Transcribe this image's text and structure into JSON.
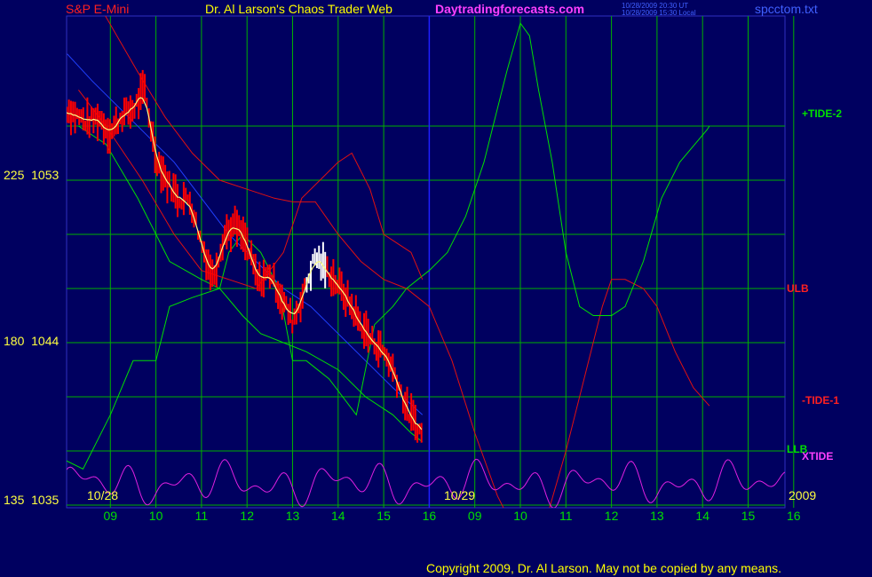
{
  "header": {
    "instrument": "S&P E-Mini",
    "title": "Dr. Al Larson's Chaos Trader Web",
    "site": "Daytradingforecasts.com",
    "ut_stamp": "10/28/2009 20:30 UT",
    "local_stamp": "10/28/2009 15:30 Local",
    "file": "spcctom.txt"
  },
  "footer": {
    "copyright": "Copyright 2009, Dr. Al Larson. May not be copied by any means."
  },
  "colors": {
    "background": "#000060",
    "grid": "#00b000",
    "divider": "#2020ff",
    "price": "#ff0000",
    "price_up": "#ffffff",
    "moving_avg": "#ffff80",
    "tide1": "#e01010",
    "tide2": "#00e000",
    "xtide": "#e020e0",
    "channel": "#e01010",
    "blue_line": "#2040ff"
  },
  "chart_data": {
    "type": "line",
    "title": "S&P E-Mini",
    "y_axis": {
      "ticks": [
        {
          "left": "225",
          "right": "1053",
          "value": 1053
        },
        {
          "left": "180",
          "right": "1044",
          "value": 1044
        },
        {
          "left": "135",
          "right": "1035",
          "value": 1035
        }
      ],
      "ylim": [
        1035,
        1053
      ]
    },
    "x_axis": {
      "date_labels": [
        "10/28",
        "10/29",
        "2009"
      ],
      "hour_labels": [
        "09",
        "10",
        "11",
        "12",
        "13",
        "14",
        "15",
        "16",
        "09",
        "10",
        "11",
        "12",
        "13",
        "14",
        "15",
        "16"
      ],
      "sessions": [
        "10/28",
        "10/29"
      ]
    },
    "series": [
      {
        "name": "+TIDE-2",
        "color": "#00e000"
      },
      {
        "name": "ULB",
        "color": "#e01010"
      },
      {
        "name": "-TIDE-1",
        "color": "#e01010"
      },
      {
        "name": "LLB",
        "color": "#00e000"
      },
      {
        "name": "XTIDE",
        "color": "#e020e0"
      }
    ],
    "right_labels": [
      {
        "text": "+TIDE-2",
        "color": "#00e000"
      },
      {
        "text": "ULB",
        "color": "#ff2020"
      },
      {
        "text": "-TIDE-1",
        "color": "#ff2020"
      },
      {
        "text": "LLB",
        "color": "#00e000"
      },
      {
        "text": "XTIDE",
        "color": "#ff40ff"
      }
    ],
    "price_path": [
      [
        0,
        1057.0
      ],
      [
        0.25,
        1056.6
      ],
      [
        0.5,
        1056.2
      ],
      [
        0.75,
        1056.5
      ],
      [
        1.0,
        1055.6
      ],
      [
        1.25,
        1056.6
      ],
      [
        1.5,
        1056.9
      ],
      [
        1.75,
        1058.0
      ],
      [
        2.0,
        1054.3
      ],
      [
        2.25,
        1052.9
      ],
      [
        2.5,
        1052.0
      ],
      [
        2.75,
        1051.9
      ],
      [
        3.0,
        1049.5
      ],
      [
        3.25,
        1047.6
      ],
      [
        3.5,
        1050.0
      ],
      [
        3.75,
        1050.5
      ],
      [
        4.0,
        1049.4
      ],
      [
        4.25,
        1047.3
      ],
      [
        4.5,
        1047.9
      ],
      [
        4.75,
        1046.5
      ],
      [
        5.0,
        1045.2
      ],
      [
        5.25,
        1046.8
      ],
      [
        5.5,
        1048.8
      ],
      [
        5.75,
        1048.0
      ],
      [
        6.0,
        1047.2
      ],
      [
        6.25,
        1046.2
      ],
      [
        6.5,
        1045.0
      ],
      [
        6.75,
        1044.1
      ],
      [
        7.0,
        1043.5
      ],
      [
        7.25,
        1042.3
      ],
      [
        7.5,
        1040.3
      ],
      [
        7.75,
        1039.3
      ],
      [
        7.85,
        1038.8
      ]
    ],
    "white_bars_hour": [
      5.3,
      5.75
    ],
    "tide2_path": [
      [
        0.0,
        1037.5
      ],
      [
        0.4,
        1037.0
      ],
      [
        1.0,
        1040.0
      ],
      [
        1.5,
        1043.0
      ],
      [
        2.0,
        1043.0
      ],
      [
        2.3,
        1046.0
      ],
      [
        2.8,
        1046.5
      ],
      [
        3.4,
        1047.0
      ],
      [
        3.6,
        1049.0
      ],
      [
        3.9,
        1050.0
      ],
      [
        4.3,
        1049.0
      ],
      [
        4.7,
        1047.0
      ],
      [
        5.0,
        1043.0
      ],
      [
        5.3,
        1043.0
      ],
      [
        5.8,
        1042.0
      ],
      [
        6.4,
        1040.0
      ],
      [
        6.8,
        1045.0
      ],
      [
        7.2,
        1046.0
      ],
      [
        7.5,
        1047.0
      ],
      [
        8.0,
        1048.0
      ],
      [
        8.4,
        1049.0
      ],
      [
        8.8,
        1051.0
      ],
      [
        9.2,
        1054.0
      ],
      [
        9.7,
        1059.0
      ],
      [
        10.0,
        1061.7
      ],
      [
        10.2,
        1061.0
      ],
      [
        10.4,
        1058.0
      ],
      [
        10.7,
        1054.0
      ],
      [
        11.0,
        1049.0
      ],
      [
        11.3,
        1046.0
      ],
      [
        11.6,
        1045.5
      ],
      [
        12.0,
        1045.5
      ],
      [
        12.3,
        1046.0
      ],
      [
        12.7,
        1048.5
      ],
      [
        13.1,
        1052.0
      ],
      [
        13.5,
        1054.0
      ],
      [
        14.0,
        1055.5
      ],
      [
        14.1,
        1055.8
      ],
      [
        14.15,
        1056.0
      ]
    ],
    "tide1_path": [
      [
        0.0,
        1065.0
      ],
      [
        0.8,
        1062.5
      ],
      [
        1.6,
        1059.0
      ],
      [
        2.2,
        1056.5
      ],
      [
        2.8,
        1054.5
      ],
      [
        3.4,
        1053.0
      ],
      [
        4.0,
        1052.5
      ],
      [
        4.6,
        1052.0
      ],
      [
        5.0,
        1051.8
      ],
      [
        5.5,
        1051.8
      ],
      [
        6.0,
        1050.0
      ],
      [
        6.5,
        1048.5
      ],
      [
        7.0,
        1047.5
      ],
      [
        7.5,
        1047.0
      ],
      [
        8.0,
        1046.0
      ],
      [
        8.5,
        1043.0
      ],
      [
        9.0,
        1039.0
      ],
      [
        9.5,
        1035.5
      ],
      [
        9.9,
        1033.5
      ],
      [
        10.2,
        1033.0
      ],
      [
        10.6,
        1034.5
      ],
      [
        11.0,
        1038.0
      ],
      [
        11.4,
        1042.0
      ],
      [
        11.8,
        1046.0
      ],
      [
        12.0,
        1047.5
      ],
      [
        12.3,
        1047.5
      ],
      [
        12.7,
        1047.0
      ],
      [
        13.0,
        1046.0
      ],
      [
        13.4,
        1043.5
      ],
      [
        13.8,
        1041.5
      ],
      [
        14.15,
        1040.5
      ]
    ],
    "ulb_path": [
      [
        0.3,
        1058.0
      ],
      [
        0.9,
        1056.0
      ],
      [
        1.7,
        1053.0
      ],
      [
        2.4,
        1050.0
      ],
      [
        3.0,
        1048.0
      ],
      [
        3.6,
        1047.5
      ],
      [
        4.2,
        1047.0
      ],
      [
        4.8,
        1049.0
      ],
      [
        5.2,
        1052.0
      ],
      [
        5.6,
        1053.0
      ],
      [
        6.0,
        1054.0
      ],
      [
        6.3,
        1054.5
      ],
      [
        6.7,
        1052.5
      ],
      [
        7.0,
        1050.0
      ],
      [
        7.3,
        1049.5
      ],
      [
        7.6,
        1049.0
      ],
      [
        7.85,
        1047.5
      ]
    ],
    "llb_path": [
      [
        0.3,
        1056.0
      ],
      [
        0.9,
        1055.0
      ],
      [
        1.6,
        1052.0
      ],
      [
        2.3,
        1048.5
      ],
      [
        3.0,
        1047.5
      ],
      [
        3.4,
        1047.0
      ],
      [
        3.9,
        1045.5
      ],
      [
        4.3,
        1044.5
      ],
      [
        4.8,
        1044.0
      ],
      [
        5.3,
        1043.5
      ],
      [
        6.0,
        1042.5
      ],
      [
        6.6,
        1041.0
      ],
      [
        7.2,
        1040.0
      ],
      [
        7.6,
        1039.0
      ],
      [
        7.85,
        1038.5
      ]
    ],
    "blue_path": [
      [
        0.05,
        1060.0
      ],
      [
        0.6,
        1058.5
      ],
      [
        1.2,
        1057.0
      ],
      [
        1.8,
        1055.5
      ],
      [
        2.4,
        1054.0
      ],
      [
        3.0,
        1052.0
      ],
      [
        3.6,
        1050.0
      ],
      [
        4.2,
        1048.5
      ],
      [
        4.8,
        1047.0
      ],
      [
        5.4,
        1046.0
      ],
      [
        6.0,
        1044.5
      ],
      [
        6.6,
        1043.0
      ],
      [
        7.2,
        1041.5
      ],
      [
        7.85,
        1040.0
      ]
    ]
  }
}
